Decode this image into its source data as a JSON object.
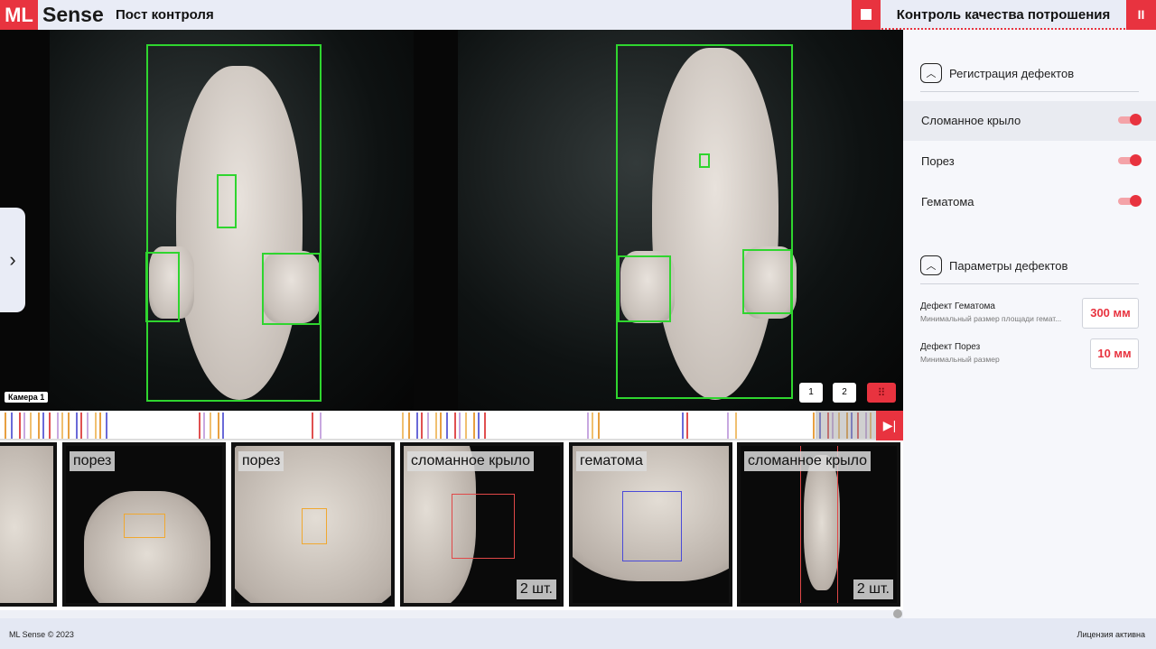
{
  "header": {
    "logo_ml": "ML",
    "logo_sense": "Sense",
    "post_title": "Пост контроля",
    "process_title": "Контроль качества потрошения",
    "pause_label": "II"
  },
  "camera": {
    "label": "Камера 1",
    "buttons": [
      "1",
      "2"
    ]
  },
  "thumbnails": [
    {
      "label": "",
      "count": ""
    },
    {
      "label": "порез",
      "count": ""
    },
    {
      "label": "порез",
      "count": ""
    },
    {
      "label": "сломанное крыло",
      "count": "2 шт."
    },
    {
      "label": "гематома",
      "count": ""
    },
    {
      "label": "сломанное крыло",
      "count": "2 шт."
    }
  ],
  "right": {
    "section1": "Регистрация дефектов",
    "toggles": [
      {
        "label": "Сломанное крыло",
        "on": true
      },
      {
        "label": "Порез",
        "on": true
      },
      {
        "label": "Гематома",
        "on": true
      }
    ],
    "section2": "Параметры дефектов",
    "params": [
      {
        "name": "Дефект Гематома",
        "desc": "Минимальный размер площади гемат...",
        "value": "300 мм"
      },
      {
        "name": "Дефект Порез",
        "desc": "Минимальный размер",
        "value": "10 мм"
      }
    ]
  },
  "footer": {
    "copyright": "ML Sense © 2023",
    "license": "Лицензия активна"
  },
  "colors": {
    "accent": "#e8333f",
    "bbox": "#2fd52f",
    "cut": "#f0a830",
    "broken_wing": "#e04848",
    "hematoma": "#4a4ad8"
  }
}
